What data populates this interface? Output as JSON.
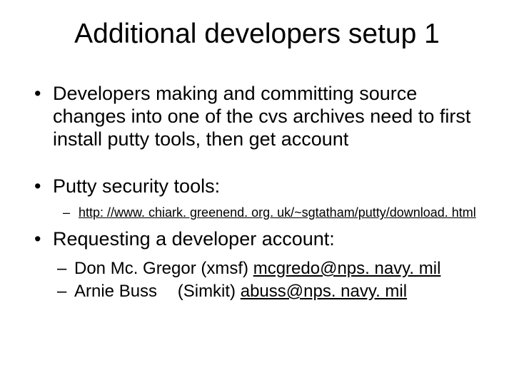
{
  "title": "Additional developers setup   1",
  "bullets": {
    "b1": "Developers making and committing source changes into one of the cvs archives need to first install putty tools, then get account",
    "b2": "Putty security tools:",
    "b2_sub1": "http: //www. chiark. greenend. org. uk/~sgtatham/putty/download. html",
    "b3": "Requesting a developer account:",
    "b3_sub1_name": "Don Mc. Gregor",
    "b3_sub1_role": "(xmsf)",
    "b3_sub1_email": "mcgredo@nps. navy. mil",
    "b3_sub2_name": "Arnie Buss",
    "b3_sub2_role": "(Simkit)",
    "b3_sub2_email": "abuss@nps. navy. mil"
  }
}
